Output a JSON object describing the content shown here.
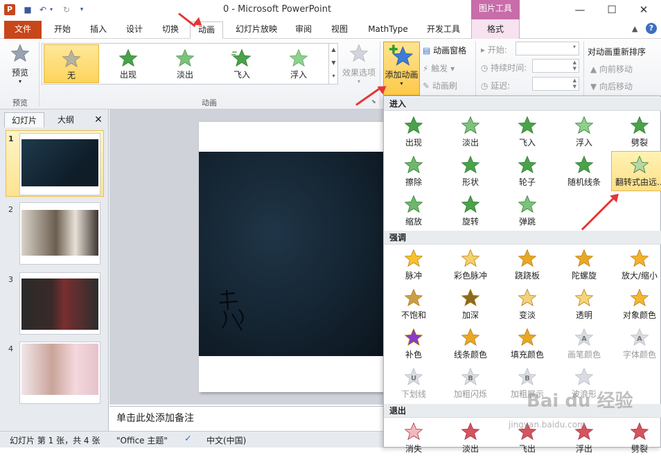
{
  "window": {
    "title": "0 - Microsoft PowerPoint",
    "context_tool": "图片工具",
    "logo_letter": "P"
  },
  "tabs": [
    "文件",
    "开始",
    "插入",
    "设计",
    "切换",
    "动画",
    "幻灯片放映",
    "审阅",
    "视图",
    "MathType",
    "开发工具",
    "格式"
  ],
  "ribbon": {
    "preview_label": "预览",
    "preview_group": "预览",
    "anim_group": "动画",
    "gallery": [
      "无",
      "出现",
      "淡出",
      "飞入",
      "浮入"
    ],
    "effect_options": "效果选项",
    "add_animation": "添加动画",
    "anim_pane": "动画窗格",
    "trigger": "触发",
    "anim_painter": "动画刷",
    "start_label": "开始:",
    "duration_label": "持续时间:",
    "delay_label": "延迟:",
    "reorder_title": "对动画重新排序",
    "move_earlier": "向前移动",
    "move_later": "向后移动"
  },
  "left_panel": {
    "tab_slides": "幻灯片",
    "tab_outline": "大纲",
    "slide_numbers": [
      "1",
      "2",
      "3",
      "4"
    ]
  },
  "notes_placeholder": "单击此处添加备注",
  "status": {
    "slide_info": "幻灯片 第 1 张，共 4 张",
    "theme": "\"Office 主题\"",
    "language": "中文(中国)"
  },
  "dropdown": {
    "entrance_title": "进入",
    "entrance": [
      "出现",
      "淡出",
      "飞入",
      "浮入",
      "劈裂",
      "擦除",
      "形状",
      "轮子",
      "随机线条",
      "翻转式由远...",
      "缩放",
      "旋转",
      "弹跳"
    ],
    "emphasis_title": "强调",
    "emphasis": [
      "脉冲",
      "彩色脉冲",
      "跷跷板",
      "陀螺旋",
      "放大/缩小",
      "不饱和",
      "加深",
      "变淡",
      "透明",
      "对象颜色",
      "补色",
      "线条颜色",
      "填充颜色",
      "画笔颜色",
      "字体颜色",
      "下划线",
      "加粗闪烁",
      "加粗展示",
      "波浪形"
    ],
    "exit_title": "退出",
    "exit": [
      "消失",
      "淡出",
      "飞出",
      "浮出",
      "劈裂"
    ]
  },
  "watermark": "Bai du 经验",
  "watermark_url": "jingyan.baidu.com",
  "colors": {
    "file_tab": "#c8461b",
    "context_tool": "#c86caa",
    "highlight": "#fdd35c",
    "arrow": "#e53535"
  }
}
